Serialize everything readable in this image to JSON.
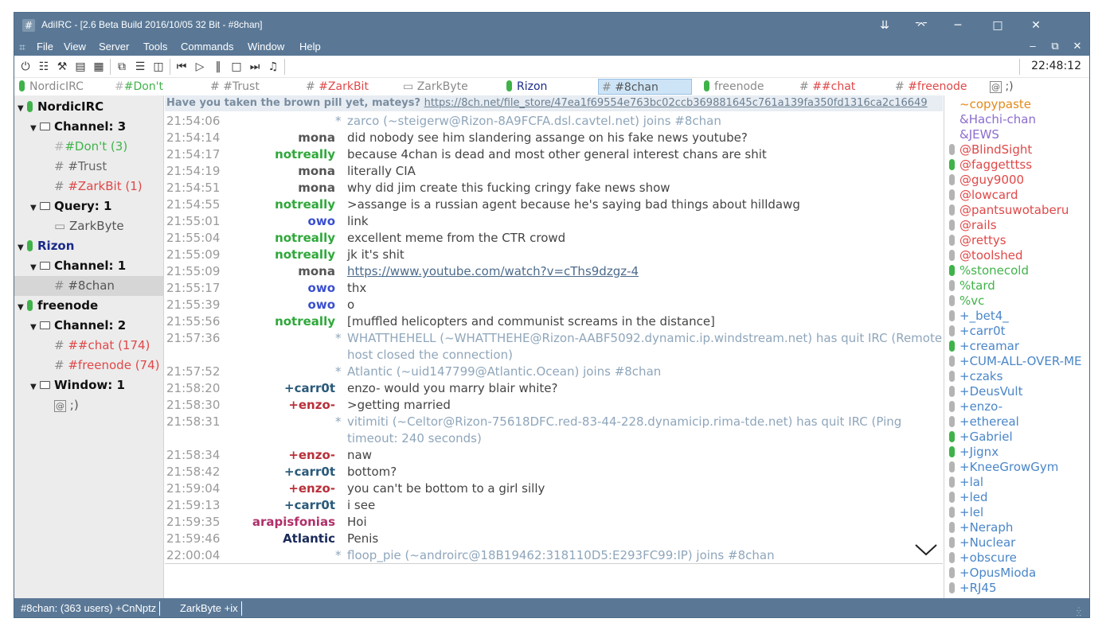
{
  "window": {
    "title": "AdiIRC - [2.6 Beta Build 2016/10/05 32 Bit - #8chan]",
    "app_icon": "#"
  },
  "menu": [
    "File",
    "View",
    "Server",
    "Tools",
    "Commands",
    "Window",
    "Help"
  ],
  "toolbar": {
    "clock": "22:48:12"
  },
  "tabs": [
    {
      "label": "NordicIRC",
      "color": "#8a8a8a",
      "pill": "green",
      "icon": ""
    },
    {
      "label": "#Don't",
      "color": "#41b34b",
      "pill": "",
      "icon": "#"
    },
    {
      "label": "#Trust",
      "color": "#8a8a8a",
      "pill": "",
      "icon": "#"
    },
    {
      "label": "#ZarkBit",
      "color": "#e04848",
      "pill": "",
      "icon": "#"
    },
    {
      "label": "ZarkByte",
      "color": "#8a8a8a",
      "pill": "",
      "icon": "query"
    },
    {
      "label": "Rizon",
      "color": "#1a2a8a",
      "pill": "green",
      "icon": ""
    },
    {
      "label": "#8chan",
      "color": "#555555",
      "pill": "",
      "icon": "#",
      "active": true
    },
    {
      "label": "freenode",
      "color": "#8a8a8a",
      "pill": "green",
      "icon": ""
    },
    {
      "label": "##chat",
      "color": "#e04848",
      "pill": "",
      "icon": "#"
    },
    {
      "label": "#freenode",
      "color": "#e04848",
      "pill": "",
      "icon": "#"
    },
    {
      "label": ";)",
      "color": "#555555",
      "pill": "",
      "icon": "window"
    }
  ],
  "tree": [
    {
      "label": "NordicIRC",
      "type": "server"
    },
    {
      "label": "Channel: 3",
      "type": "group"
    },
    {
      "label": "#Don't (3)",
      "type": "channel",
      "color": "#41b34b"
    },
    {
      "label": "#Trust",
      "type": "channel",
      "color": "#666666"
    },
    {
      "label": "#ZarkBit (1)",
      "type": "channel",
      "color": "#e04848"
    },
    {
      "label": "Query: 1",
      "type": "group"
    },
    {
      "label": "ZarkByte",
      "type": "query",
      "color": "#555555"
    },
    {
      "label": "Rizon",
      "type": "server",
      "color": "#1a2a8a"
    },
    {
      "label": "Channel: 1",
      "type": "group"
    },
    {
      "label": "#8chan",
      "type": "channel",
      "color": "#555555",
      "selected": true
    },
    {
      "label": "freenode",
      "type": "server"
    },
    {
      "label": "Channel: 2",
      "type": "group"
    },
    {
      "label": "##chat (174)",
      "type": "channel",
      "color": "#e04848"
    },
    {
      "label": "#freenode (74)",
      "type": "channel",
      "color": "#e04848"
    },
    {
      "label": "Window: 1",
      "type": "group"
    },
    {
      "label": ";)",
      "type": "window",
      "color": "#555555"
    }
  ],
  "topic": {
    "text": "Have you taken the brown pill yet, mateys?",
    "url": "https://8ch.net/file_store/47ea1f69554e763bc02ccb369881645c761a139fa350fd1316ca2c16649"
  },
  "messages": [
    {
      "ts": "21:54:06",
      "nick": "",
      "text": "zarco (~steigerw@Rizon-8A9FCFA.dsl.cavtel.net) joins #8chan",
      "event": true
    },
    {
      "ts": "21:54:14",
      "nick": "mona",
      "nick_color": "#555555",
      "text": "did nobody see him slandering assange on his fake news youtube?"
    },
    {
      "ts": "21:54:17",
      "nick": "notreally",
      "nick_color": "#2fa83a",
      "text": "because 4chan is dead and most other general interest chans are shit"
    },
    {
      "ts": "21:54:19",
      "nick": "mona",
      "nick_color": "#555555",
      "text": "literally CIA"
    },
    {
      "ts": "21:54:51",
      "nick": "mona",
      "nick_color": "#555555",
      "text": "why did jim create this fucking cringy fake news show"
    },
    {
      "ts": "21:54:55",
      "nick": "notreally",
      "nick_color": "#2fa83a",
      "text": ">assange is a russian agent because he's saying bad things about hilldawg"
    },
    {
      "ts": "21:55:01",
      "nick": "owo",
      "nick_color": "#3a4fcf",
      "text": "link"
    },
    {
      "ts": "21:55:04",
      "nick": "notreally",
      "nick_color": "#2fa83a",
      "text": "excellent meme from the CTR crowd"
    },
    {
      "ts": "21:55:09",
      "nick": "notreally",
      "nick_color": "#2fa83a",
      "text": "jk it's shit"
    },
    {
      "ts": "21:55:09",
      "nick": "mona",
      "nick_color": "#555555",
      "text": "https://www.youtube.com/watch?v=cThs9dzgz-4",
      "url": true
    },
    {
      "ts": "21:55:17",
      "nick": "owo",
      "nick_color": "#3a4fcf",
      "text": "thx"
    },
    {
      "ts": "21:55:39",
      "nick": "owo",
      "nick_color": "#3a4fcf",
      "text": "o"
    },
    {
      "ts": "21:55:56",
      "nick": "notreally",
      "nick_color": "#2fa83a",
      "text": "[muffled helicopters and communist screams in the distance]"
    },
    {
      "ts": "21:57:36",
      "nick": "",
      "text": "WHATTHEHELL (~WHATTHEHE@Rizon-AABF5092.dynamic.ip.windstream.net) has quit IRC (Remote",
      "event": true
    },
    {
      "ts": "",
      "nick": "",
      "text": "host closed the connection)",
      "event": true,
      "cont": true
    },
    {
      "ts": "21:57:52",
      "nick": "",
      "text": "Atlantic (~uid147799@Atlantic.Ocean) joins #8chan",
      "event": true
    },
    {
      "ts": "21:58:20",
      "nick": "+carr0t",
      "nick_color": "#2a5a7a",
      "text": "enzo- would you marry blair white?"
    },
    {
      "ts": "21:58:30",
      "nick": "+enzo-",
      "nick_color": "#b8303a",
      "text": ">getting married"
    },
    {
      "ts": "21:58:31",
      "nick": "",
      "text": "vitimiti (~Celtor@Rizon-75618DFC.red-83-44-228.dynamicip.rima-tde.net) has quit IRC (Ping",
      "event": true
    },
    {
      "ts": "",
      "nick": "",
      "text": "timeout: 240 seconds)",
      "event": true,
      "cont": true
    },
    {
      "ts": "21:58:34",
      "nick": "+enzo-",
      "nick_color": "#b8303a",
      "text": "naw"
    },
    {
      "ts": "21:58:42",
      "nick": "+carr0t",
      "nick_color": "#2a5a7a",
      "text": "bottom?"
    },
    {
      "ts": "21:59:04",
      "nick": "+enzo-",
      "nick_color": "#b8303a",
      "text": "you can't be bottom to a girl silly"
    },
    {
      "ts": "21:59:13",
      "nick": "+carr0t",
      "nick_color": "#2a5a7a",
      "text": "i see"
    },
    {
      "ts": "21:59:35",
      "nick": "arapisfonias",
      "nick_color": "#b0306a",
      "text": "Hoi"
    },
    {
      "ts": "21:59:46",
      "nick": "Atlantic",
      "nick_color": "#1a2a5a",
      "text": "Penis"
    },
    {
      "ts": "22:00:04",
      "nick": "",
      "text": "floop_pie (~androirc@18B19462:318110D5:E293FC99:IP) joins #8chan",
      "event": true
    }
  ],
  "nicklist": [
    {
      "name": "~copypaste",
      "color": "#e38a1a",
      "pill": ""
    },
    {
      "name": "&Hachi-chan",
      "color": "#8c6ccf",
      "pill": ""
    },
    {
      "name": "&JEWS",
      "color": "#8c6ccf",
      "pill": ""
    },
    {
      "name": "@BlindSight",
      "color": "#e04848",
      "pill": "gray"
    },
    {
      "name": "@faggetttss",
      "color": "#e04848",
      "pill": "green"
    },
    {
      "name": "@guy9000",
      "color": "#e04848",
      "pill": "gray"
    },
    {
      "name": "@lowcard",
      "color": "#e04848",
      "pill": "gray"
    },
    {
      "name": "@pantsuwotaberu",
      "color": "#e04848",
      "pill": "gray"
    },
    {
      "name": "@rails",
      "color": "#e04848",
      "pill": "gray"
    },
    {
      "name": "@rettys",
      "color": "#e04848",
      "pill": "gray"
    },
    {
      "name": "@toolshed",
      "color": "#e04848",
      "pill": "gray"
    },
    {
      "name": "%stonecold",
      "color": "#41b34b",
      "pill": "green"
    },
    {
      "name": "%tard",
      "color": "#41b34b",
      "pill": "gray"
    },
    {
      "name": "%vc",
      "color": "#41b34b",
      "pill": "gray"
    },
    {
      "name": "+_bet4_",
      "color": "#4a86c8",
      "pill": "gray"
    },
    {
      "name": "+carr0t",
      "color": "#4a86c8",
      "pill": "gray"
    },
    {
      "name": "+creamar",
      "color": "#4a86c8",
      "pill": "green"
    },
    {
      "name": "+CUM-ALL-OVER-ME",
      "color": "#4a86c8",
      "pill": "gray"
    },
    {
      "name": "+czaks",
      "color": "#4a86c8",
      "pill": "gray"
    },
    {
      "name": "+DeusVult",
      "color": "#4a86c8",
      "pill": "gray"
    },
    {
      "name": "+enzo-",
      "color": "#4a86c8",
      "pill": "gray"
    },
    {
      "name": "+ethereal",
      "color": "#4a86c8",
      "pill": "gray"
    },
    {
      "name": "+Gabriel",
      "color": "#4a86c8",
      "pill": "green"
    },
    {
      "name": "+Jignx",
      "color": "#4a86c8",
      "pill": "green"
    },
    {
      "name": "+KneeGrowGym",
      "color": "#4a86c8",
      "pill": "gray"
    },
    {
      "name": "+lal",
      "color": "#4a86c8",
      "pill": "gray"
    },
    {
      "name": "+led",
      "color": "#4a86c8",
      "pill": "gray"
    },
    {
      "name": "+lel",
      "color": "#4a86c8",
      "pill": "gray"
    },
    {
      "name": "+Neraph",
      "color": "#4a86c8",
      "pill": "gray"
    },
    {
      "name": "+Nuclear",
      "color": "#4a86c8",
      "pill": "gray"
    },
    {
      "name": "+obscure",
      "color": "#4a86c8",
      "pill": "gray"
    },
    {
      "name": "+OpusMioda",
      "color": "#4a86c8",
      "pill": "gray"
    },
    {
      "name": "+RJ45",
      "color": "#4a86c8",
      "pill": "gray"
    }
  ],
  "statusbar": {
    "channel": "#8chan: (363 users) +CnNptz",
    "user": "ZarkByte +ix"
  }
}
